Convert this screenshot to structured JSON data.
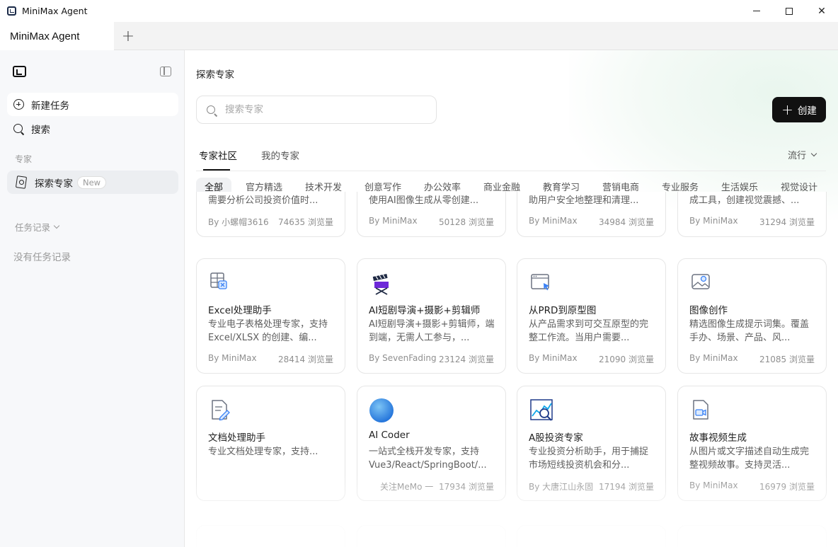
{
  "window": {
    "title": "MiniMax Agent",
    "controls": {
      "close": "✕"
    }
  },
  "tabstrip": {
    "active_tab": "MiniMax Agent",
    "add_tab": "+"
  },
  "sidebar": {
    "new_task": "新建任务",
    "search": "搜索",
    "section_experts": "专家",
    "explore_experts": "探索专家",
    "new_badge": "New",
    "history_label": "任务记录",
    "history_empty": "没有任务记录"
  },
  "main": {
    "title": "探索专家",
    "search_placeholder": "搜索专家",
    "create_label": "创建",
    "tabs": [
      "专家社区",
      "我的专家"
    ],
    "sort_label": "流行",
    "categories": [
      "全部",
      "官方精选",
      "技术开发",
      "创意写作",
      "办公效率",
      "商业金融",
      "教育学习",
      "营销电商",
      "专业服务",
      "生活娱乐",
      "视觉设计"
    ],
    "top_cards": [
      {
        "desc": "需要分析公司投资价值时...",
        "author": "By 小螺帽3616",
        "views": "74635 浏览量"
      },
      {
        "desc": "使用AI图像生成从零创建...",
        "author": "By MiniMax",
        "views": "50128 浏览量"
      },
      {
        "desc": "助用户安全地整理和清理...",
        "author": "By MiniMax",
        "views": "34984 浏览量"
      },
      {
        "desc": "成工具，创建视觉震撼、...",
        "author": "By MiniMax",
        "views": "31294 浏览量"
      }
    ],
    "cards": [
      {
        "icon": "excel-icon",
        "title": "Excel处理助手",
        "desc": "专业电子表格处理专家，支持 Excel/XLSX 的创建、编...",
        "author": "By MiniMax",
        "views": "28414 浏览量"
      },
      {
        "icon": "clapperboard-icon",
        "title": "AI短剧导演+摄影+剪辑师",
        "desc": "AI短剧导演+摄影+剪辑师，端到端，无需人工参与，...",
        "author": "By SevenFading",
        "views": "23124 浏览量"
      },
      {
        "icon": "prototype-icon",
        "title": "从PRD到原型图",
        "desc": "从产品需求到可交互原型的完整工作流。当用户需要...",
        "author": "By MiniMax",
        "views": "21090 浏览量"
      },
      {
        "icon": "image-icon",
        "title": "图像创作",
        "desc": "精选图像生成提示词集。覆盖手办、场景、产品、风...",
        "author": "By MiniMax",
        "views": "21085 浏览量"
      },
      {
        "icon": "document-edit-icon",
        "title": "文档处理助手",
        "desc": "专业文档处理专家，支持...",
        "author": "",
        "views": ""
      },
      {
        "icon": "ai-avatar-icon",
        "title": "AI Coder",
        "desc": "一站式全栈开发专家，支持Vue3/React/SpringBoot/...",
        "author": "关注MeMo 一",
        "views": "17934 浏览量"
      },
      {
        "icon": "stock-chart-icon",
        "title": "A股投资专家",
        "desc": "专业投资分析助手，用于捕捉市场短线投资机会和分...",
        "author": "By 大唐江山永固",
        "views": "17194 浏览量"
      },
      {
        "icon": "video-icon",
        "title": "故事视频生成",
        "desc": "从图片或文字描述自动生成完整视频故事。支持灵活...",
        "author": "By MiniMax",
        "views": "16979 浏览量"
      }
    ]
  },
  "colors": {
    "accent": "#111111",
    "glow": "#e9f6ee",
    "sidebar_bg": "#f7f8fa"
  }
}
